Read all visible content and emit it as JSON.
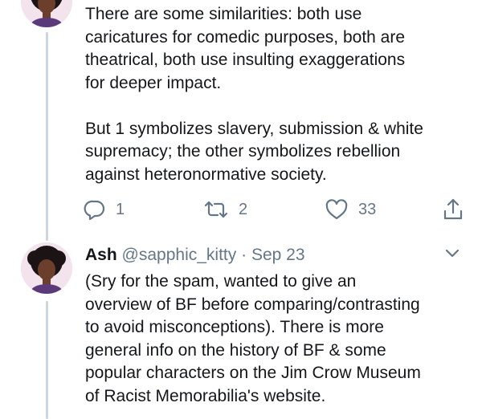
{
  "tweets": [
    {
      "text": "There are some similarities: both use\ncaricatures for comedic purposes, both are\ntheatrical, both use insulting exaggerations\nfor deeper impact.\n\nBut 1 symbolizes slavery, submission & white\nsupremacy; the other symbolizes rebellion\nagainst heteronormative society.",
      "replies": "1",
      "retweets": "2",
      "likes": "33"
    },
    {
      "display_name": "Ash",
      "handle": "@sapphic_kitty",
      "separator": "·",
      "date": "Sep 23",
      "text": "(Sry for the spam, wanted to give an\noverview of BF before comparing/contrasting\nto avoid misconceptions). There is more\ngeneral info on the history of BF & some\npopular characters on the Jim Crow Museum\nof Racist Memorabilia's website."
    }
  ],
  "icons": {
    "reply": "reply-icon",
    "retweet": "retweet-icon",
    "like": "heart-icon",
    "share": "share-icon",
    "more": "chevron-down-icon"
  },
  "colors": {
    "text": "#14171a",
    "secondary": "#657786",
    "thread_line": "#ccd6dd"
  }
}
